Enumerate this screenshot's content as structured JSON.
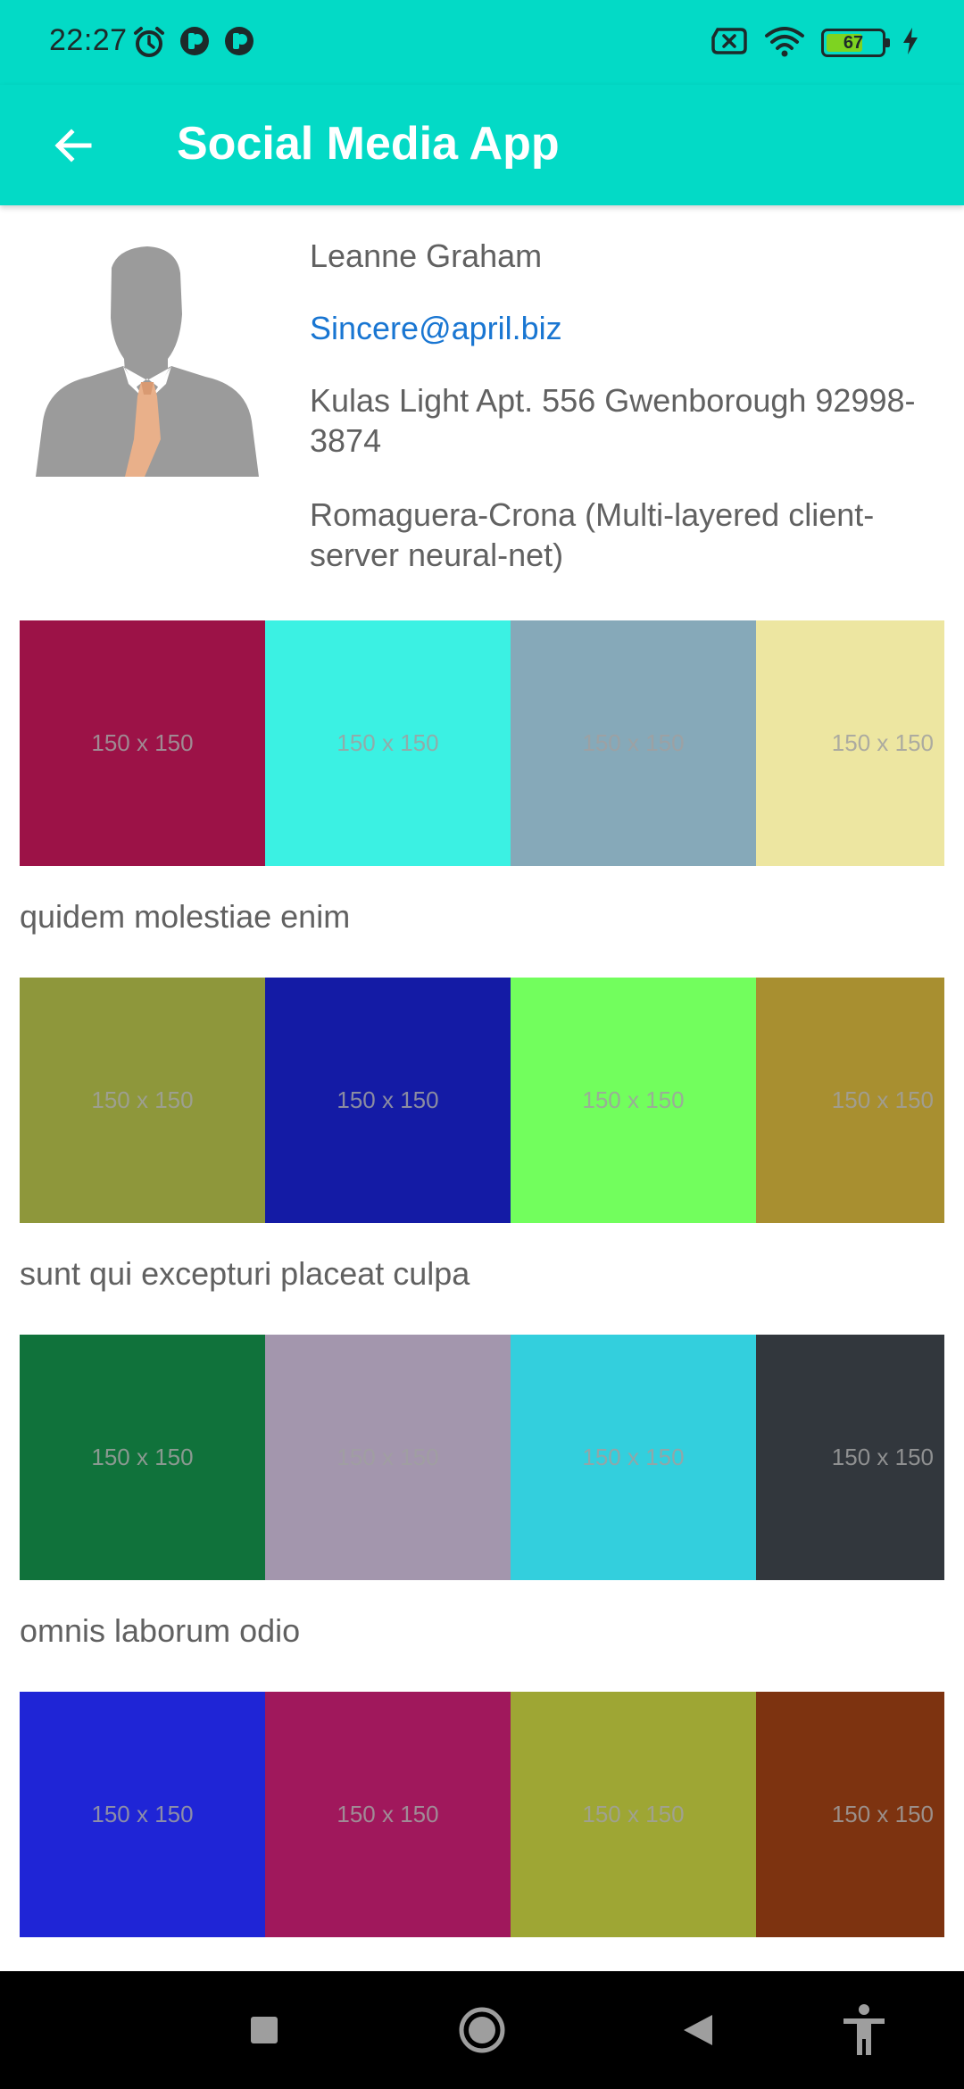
{
  "status_bar": {
    "time": "22:27",
    "battery_level": 67,
    "battery_label": "67",
    "left_icons": [
      "alarm-icon",
      "notification-app-icon",
      "notification-app-icon"
    ],
    "right_icons": [
      "sim-off-icon",
      "wifi-icon",
      "battery-icon",
      "charging-bolt-icon"
    ]
  },
  "app_bar": {
    "title": "Social Media App",
    "back_icon": "arrow-left-icon",
    "color": "#03dac6"
  },
  "user": {
    "name": "Leanne Graham",
    "email": "Sincere@april.biz",
    "address": "Kulas Light Apt. 556 Gwenborough 92998-3874",
    "company": "Romaguera-Crona (Multi-layered client-server neural-net)",
    "email_color": "#1976d2"
  },
  "albums": [
    {
      "title": "quidem molestiae enim",
      "photos": [
        {
          "label": "150 x 150",
          "color": "#9c1247"
        },
        {
          "label": "150 x 150",
          "color": "#3bf1e3"
        },
        {
          "label": "150 x 150",
          "color": "#86a9b9"
        },
        {
          "label": "150 x 150",
          "color": "#ede6a1"
        }
      ]
    },
    {
      "title": "sunt qui excepturi placeat culpa",
      "photos": [
        {
          "label": "150 x 150",
          "color": "#8e973b"
        },
        {
          "label": "150 x 150",
          "color": "#141ba5"
        },
        {
          "label": "150 x 150",
          "color": "#72fe5d"
        },
        {
          "label": "150 x 150",
          "color": "#a88f30"
        }
      ]
    },
    {
      "title": "omnis laborum odio",
      "photos": [
        {
          "label": "150 x 150",
          "color": "#10723b"
        },
        {
          "label": "150 x 150",
          "color": "#a396ad"
        },
        {
          "label": "150 x 150",
          "color": "#33cfdd"
        },
        {
          "label": "150 x 150",
          "color": "#32373d"
        }
      ]
    },
    {
      "title": "",
      "photos": [
        {
          "label": "150 x 150",
          "color": "#1f25d6"
        },
        {
          "label": "150 x 150",
          "color": "#a0185c"
        },
        {
          "label": "150 x 150",
          "color": "#9ea634"
        },
        {
          "label": "150 x 150",
          "color": "#7d3310"
        }
      ]
    }
  ],
  "nav_bar": {
    "buttons": [
      "recents-square-icon",
      "home-circle-icon",
      "back-triangle-icon",
      "accessibility-icon"
    ]
  }
}
